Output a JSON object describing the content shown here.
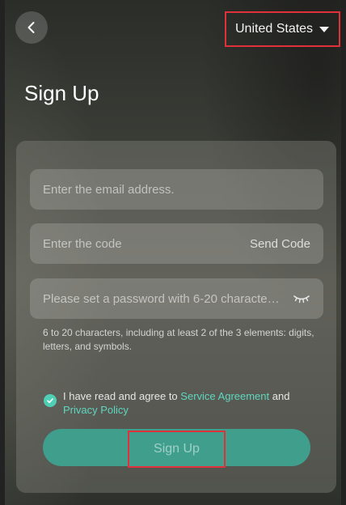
{
  "header": {
    "back_icon": "chevron-left-icon",
    "country": "United States",
    "country_icon": "caret-down-icon"
  },
  "page": {
    "title": "Sign Up"
  },
  "form": {
    "email_placeholder": "Enter the email address.",
    "code_placeholder": "Enter the code",
    "send_code_label": "Send Code",
    "password_placeholder": "Please set a password with 6-20 characte…",
    "password_icon": "eye-closed-icon",
    "password_hint": "6 to 20 characters, including at least 2 of the 3 elements: digits, letters, and symbols.",
    "agree_prefix": "I have read and agree to",
    "service_agreement": "Service Agreement",
    "and_text": "and",
    "privacy_policy": "Privacy Policy",
    "agree_checked": true,
    "submit_label": "Sign Up"
  },
  "colors": {
    "accent": "#4fd0b4",
    "button": "#3f9f8c",
    "highlight_border": "#e0303a"
  }
}
